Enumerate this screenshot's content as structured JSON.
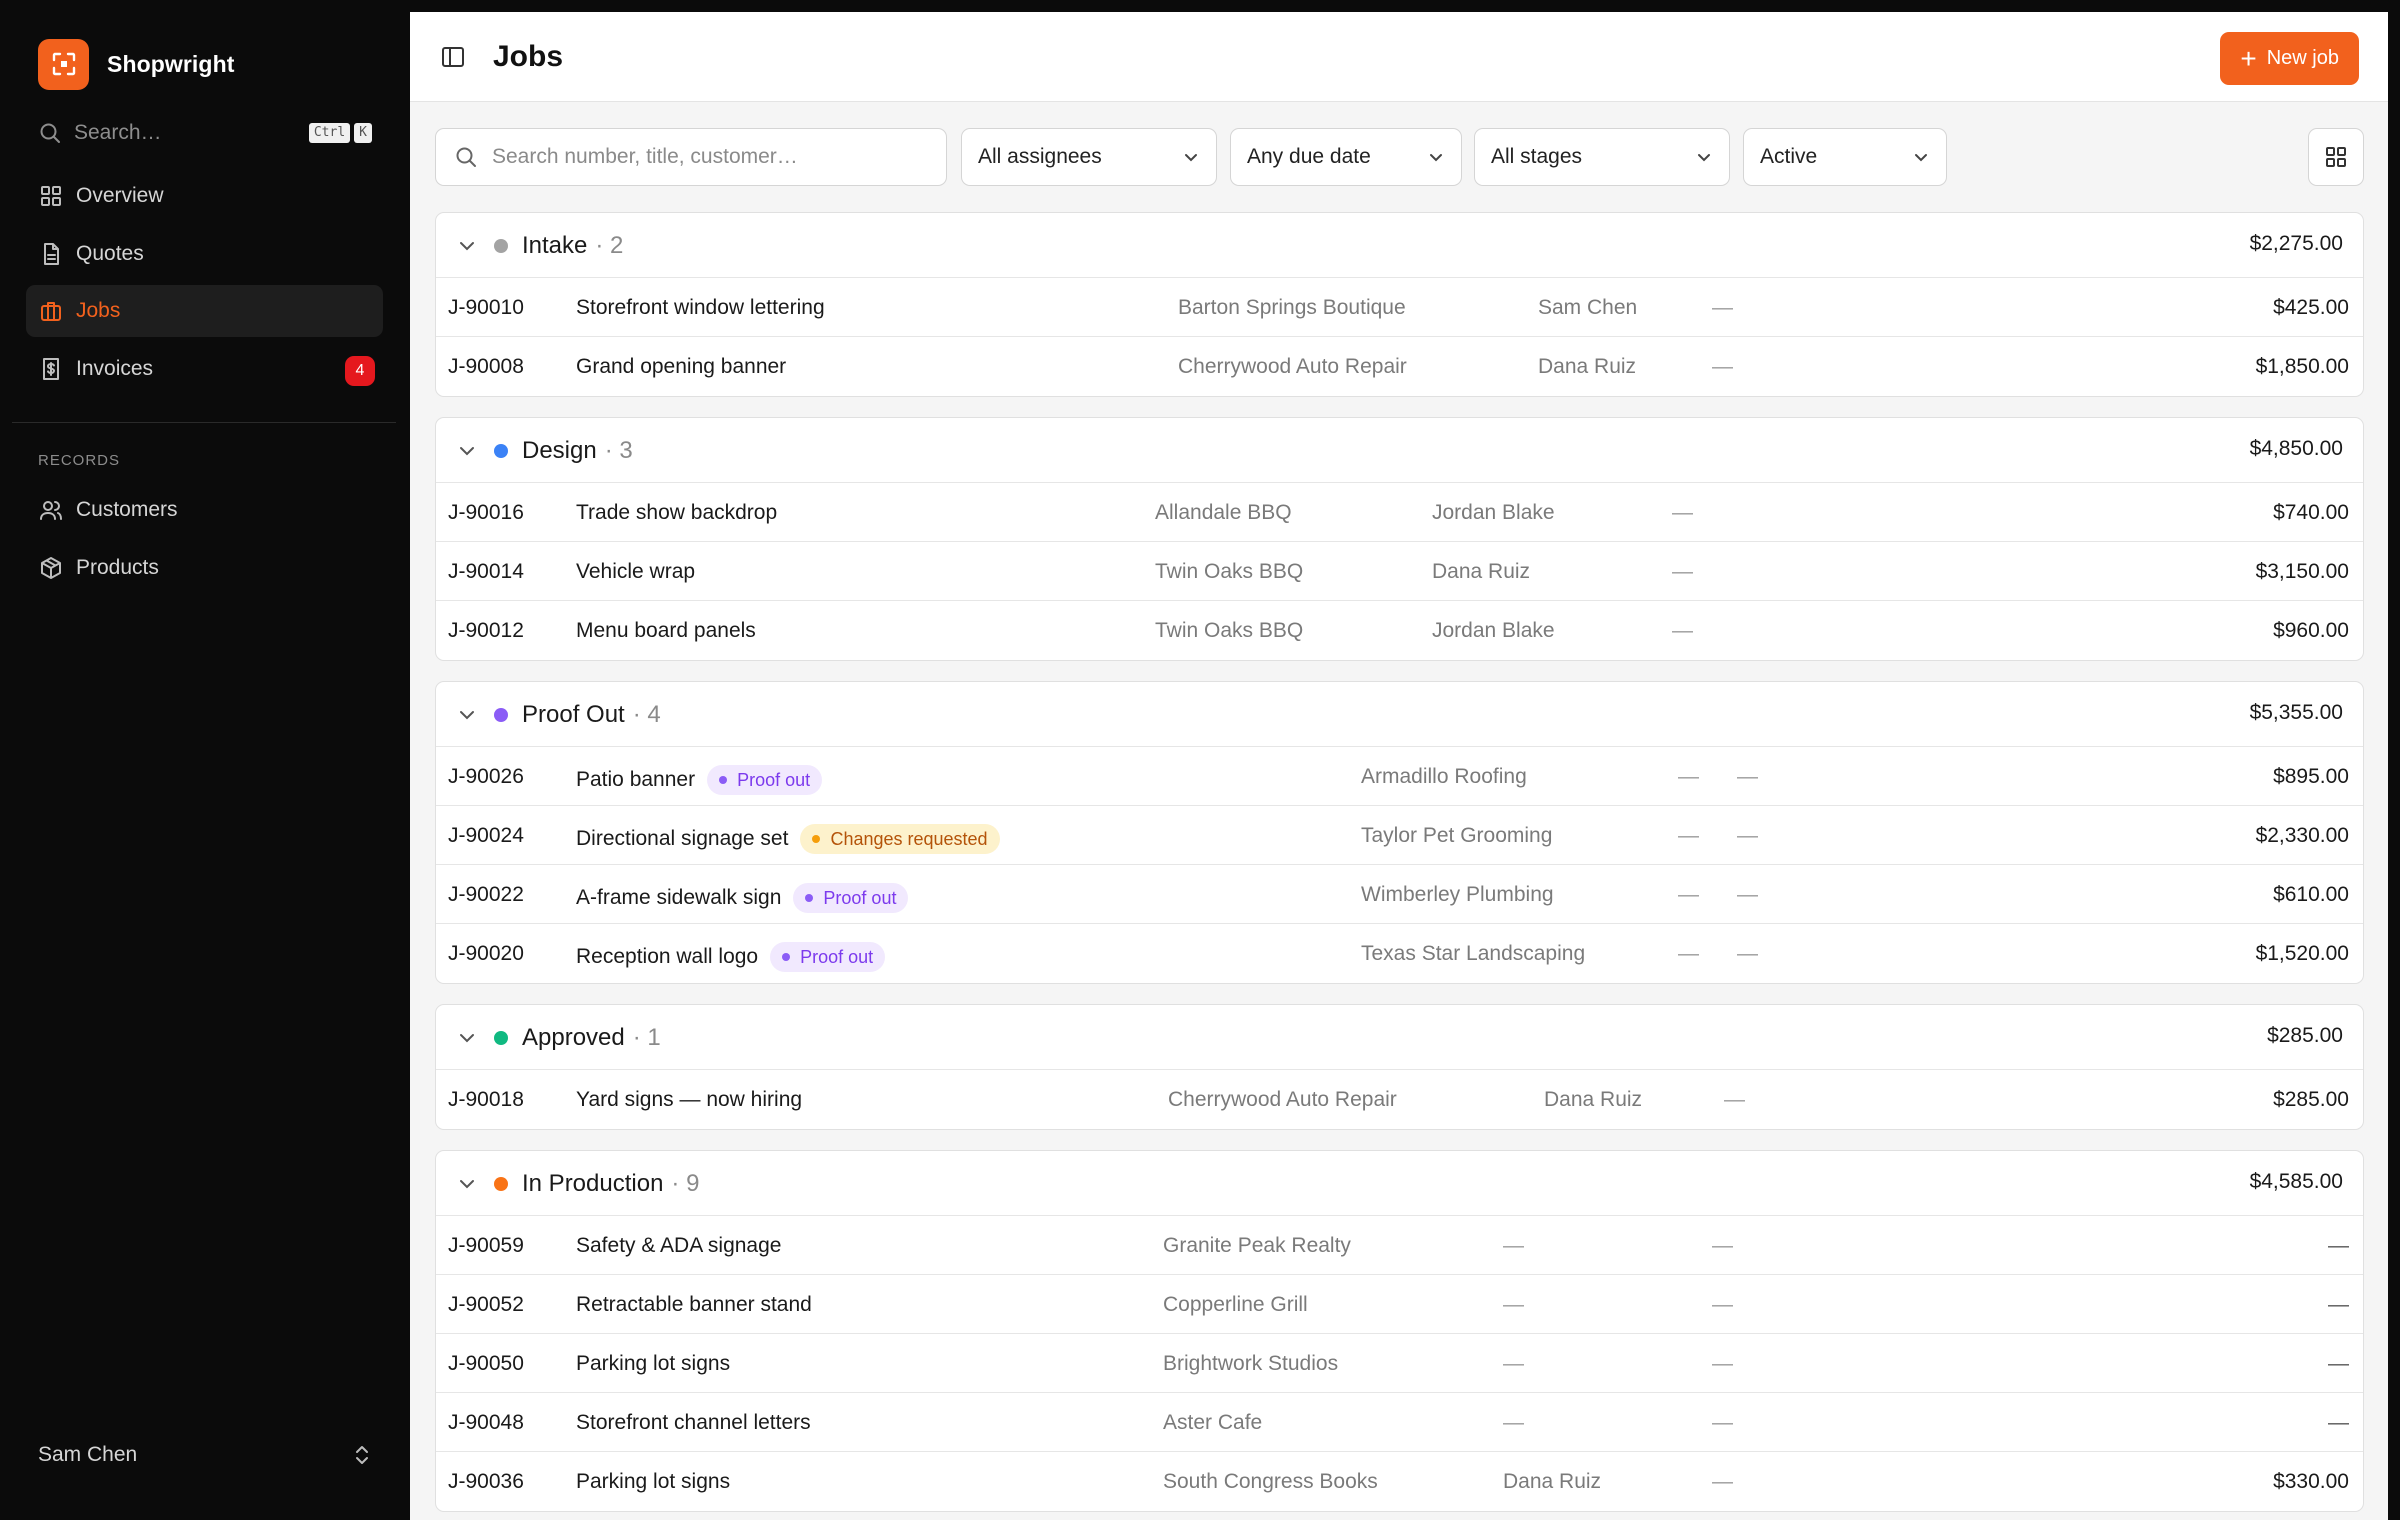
{
  "app": {
    "name": "Shopwright"
  },
  "sidebar": {
    "search_placeholder": "Search…",
    "kbd": [
      "Ctrl",
      "K"
    ],
    "nav": [
      {
        "label": "Overview",
        "icon": "grid-icon"
      },
      {
        "label": "Quotes",
        "icon": "document-icon"
      },
      {
        "label": "Jobs",
        "icon": "briefcase-icon",
        "active": true
      },
      {
        "label": "Invoices",
        "icon": "invoice-icon",
        "badge": "4"
      }
    ],
    "section_label": "RECORDS",
    "records": [
      {
        "label": "Customers",
        "icon": "users-icon"
      },
      {
        "label": "Products",
        "icon": "box-icon"
      }
    ],
    "user": "Sam Chen"
  },
  "header": {
    "title": "Jobs",
    "new_button": "New job"
  },
  "filters": {
    "search_placeholder": "Search number, title, customer…",
    "assignees": "All assignees",
    "due": "Any due date",
    "stages": "All stages",
    "status": "Active"
  },
  "groups": [
    {
      "name": "Intake",
      "count": "· 2",
      "total": "$2,275.00",
      "color": "#a3a3a3",
      "cols": {
        "cust": 742,
        "asg": 1102,
        "due": 1276
      },
      "rows": [
        {
          "num": "J-90010",
          "title": "Storefront window lettering",
          "customer": "Barton Springs Boutique",
          "assignee": "Sam Chen",
          "due": "—",
          "amount": "$425.00"
        },
        {
          "num": "J-90008",
          "title": "Grand opening banner",
          "customer": "Cherrywood Auto Repair",
          "assignee": "Dana Ruiz",
          "due": "—",
          "amount": "$1,850.00"
        }
      ]
    },
    {
      "name": "Design",
      "count": "· 3",
      "total": "$4,850.00",
      "color": "#3b82f6",
      "cols": {
        "cust": 719,
        "asg": 996,
        "due": 1236
      },
      "rows": [
        {
          "num": "J-90016",
          "title": "Trade show backdrop",
          "customer": "Allandale BBQ",
          "assignee": "Jordan Blake",
          "due": "—",
          "amount": "$740.00"
        },
        {
          "num": "J-90014",
          "title": "Vehicle wrap",
          "customer": "Twin Oaks BBQ",
          "assignee": "Dana Ruiz",
          "due": "—",
          "amount": "$3,150.00"
        },
        {
          "num": "J-90012",
          "title": "Menu board panels",
          "customer": "Twin Oaks BBQ",
          "assignee": "Jordan Blake",
          "due": "—",
          "amount": "$960.00"
        }
      ]
    },
    {
      "name": "Proof Out",
      "count": "· 4",
      "total": "$5,355.00",
      "color": "#8b5cf6",
      "cols": {
        "cust": 925,
        "asg": 1242,
        "due": 1301
      },
      "rows": [
        {
          "num": "J-90026",
          "title": "Patio banner",
          "pill": "Proof out",
          "pill_type": "proof",
          "customer": "Armadillo Roofing",
          "assignee": "—",
          "due": "—",
          "amount": "$895.00"
        },
        {
          "num": "J-90024",
          "title": "Directional signage set",
          "pill": "Changes requested",
          "pill_type": "changes",
          "customer": "Taylor Pet Grooming",
          "assignee": "—",
          "due": "—",
          "amount": "$2,330.00"
        },
        {
          "num": "J-90022",
          "title": "A-frame sidewalk sign",
          "pill": "Proof out",
          "pill_type": "proof",
          "customer": "Wimberley Plumbing",
          "assignee": "—",
          "due": "—",
          "amount": "$610.00"
        },
        {
          "num": "J-90020",
          "title": "Reception wall logo",
          "pill": "Proof out",
          "pill_type": "proof",
          "customer": "Texas Star Landscaping",
          "assignee": "—",
          "due": "—",
          "amount": "$1,520.00"
        }
      ]
    },
    {
      "name": "Approved",
      "count": "· 1",
      "total": "$285.00",
      "color": "#10b981",
      "cols": {
        "cust": 732,
        "asg": 1108,
        "due": 1288
      },
      "rows": [
        {
          "num": "J-90018",
          "title": "Yard signs — now hiring",
          "customer": "Cherrywood Auto Repair",
          "assignee": "Dana Ruiz",
          "due": "—",
          "amount": "$285.00"
        }
      ]
    },
    {
      "name": "In Production",
      "count": "· 9",
      "total": "$4,585.00",
      "color": "#f97316",
      "cols": {
        "cust": 727,
        "asg": 1067,
        "due": 1276
      },
      "rows": [
        {
          "num": "J-90059",
          "title": "Safety & ADA signage",
          "customer": "Granite Peak Realty",
          "assignee": "—",
          "due": "—",
          "amount": "—"
        },
        {
          "num": "J-90052",
          "title": "Retractable banner stand",
          "customer": "Copperline Grill",
          "assignee": "—",
          "due": "—",
          "amount": "—"
        },
        {
          "num": "J-90050",
          "title": "Parking lot signs",
          "customer": "Brightwork Studios",
          "assignee": "—",
          "due": "—",
          "amount": "—"
        },
        {
          "num": "J-90048",
          "title": "Storefront channel letters",
          "customer": "Aster Cafe",
          "assignee": "—",
          "due": "—",
          "amount": "—"
        },
        {
          "num": "J-90036",
          "title": "Parking lot signs",
          "customer": "South Congress Books",
          "assignee": "Dana Ruiz",
          "due": "—",
          "amount": "$330.00"
        }
      ]
    }
  ],
  "colors": {
    "accent": "#f2611d",
    "badge": "#e5181e"
  }
}
